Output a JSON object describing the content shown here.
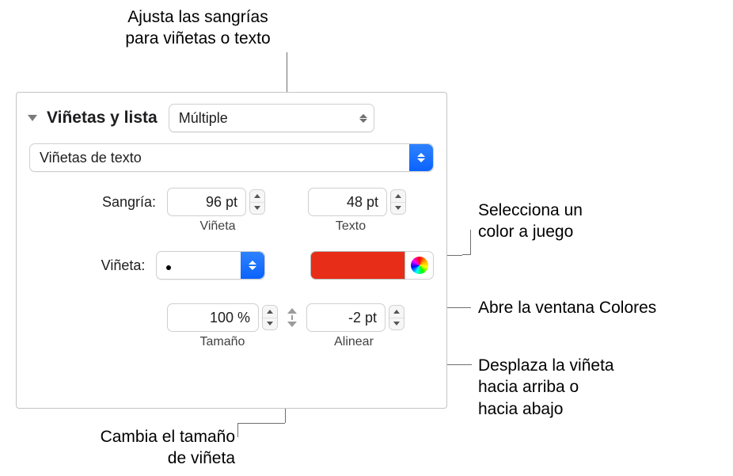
{
  "callouts": {
    "indent": "Ajusta las sangrías\npara viñetas o texto",
    "color_match": "Selecciona un\ncolor a juego",
    "colors_window": "Abre la ventana Colores",
    "shift": "Desplaza la viñeta\nhacia arriba o\nhacia abajo",
    "size": "Cambia el tamaño\nde viñeta"
  },
  "panel": {
    "title": "Viñetas y lista",
    "list_style": "Múltiple",
    "bullet_type": "Viñetas de texto",
    "labels": {
      "indent": "Sangría:",
      "bullet_sub": "Viñeta",
      "text_sub": "Texto",
      "bullet": "Viñeta:",
      "size_sub": "Tamaño",
      "align_sub": "Alinear"
    },
    "values": {
      "indent_bullet": "96 pt",
      "indent_text": "48 pt",
      "size": "100 %",
      "align": "-2 pt"
    },
    "color": "#e72d18"
  }
}
